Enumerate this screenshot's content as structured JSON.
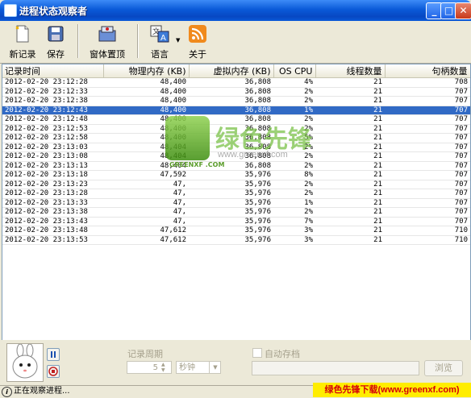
{
  "window": {
    "title": "进程状态观察者"
  },
  "toolbar": {
    "new_record": "新记录",
    "save": "保存",
    "window_top": "窗体置顶",
    "language": "语言",
    "about": "关于"
  },
  "table": {
    "columns": [
      "记录时间",
      "物理内存 (KB)",
      "虚拟内存 (KB)",
      "OS CPU",
      "线程数量",
      "句柄数量"
    ],
    "rows": [
      [
        "2012-02-20 23:12:28",
        "48,400",
        "36,808",
        "4%",
        "21",
        "708"
      ],
      [
        "2012-02-20 23:12:33",
        "48,400",
        "36,808",
        "2%",
        "21",
        "707"
      ],
      [
        "2012-02-20 23:12:38",
        "48,400",
        "36,808",
        "2%",
        "21",
        "707"
      ],
      [
        "2012-02-20 23:12:43",
        "48,400",
        "36,808",
        "1%",
        "21",
        "707"
      ],
      [
        "2012-02-20 23:12:48",
        "48,400",
        "36,808",
        "2%",
        "21",
        "707"
      ],
      [
        "2012-02-20 23:12:53",
        "48,400",
        "36,808",
        "2%",
        "21",
        "707"
      ],
      [
        "2012-02-20 23:12:58",
        "48,400",
        "36,808",
        "5%",
        "21",
        "707"
      ],
      [
        "2012-02-20 23:13:03",
        "48,404",
        "36,808",
        "2%",
        "21",
        "707"
      ],
      [
        "2012-02-20 23:13:08",
        "48,404",
        "36,808",
        "2%",
        "21",
        "707"
      ],
      [
        "2012-02-20 23:13:13",
        "48,404",
        "36,808",
        "2%",
        "21",
        "707"
      ],
      [
        "2012-02-20 23:13:18",
        "47,592",
        "35,976",
        "8%",
        "21",
        "707"
      ],
      [
        "2012-02-20 23:13:23",
        "47,",
        "35,976",
        "2%",
        "21",
        "707"
      ],
      [
        "2012-02-20 23:13:28",
        "47,",
        "35,976",
        "2%",
        "21",
        "707"
      ],
      [
        "2012-02-20 23:13:33",
        "47,",
        "35,976",
        "1%",
        "21",
        "707"
      ],
      [
        "2012-02-20 23:13:38",
        "47,",
        "35,976",
        "2%",
        "21",
        "707"
      ],
      [
        "2012-02-20 23:13:43",
        "47,",
        "35,976",
        "7%",
        "21",
        "707"
      ],
      [
        "2012-02-20 23:13:48",
        "47,612",
        "35,976",
        "3%",
        "21",
        "710"
      ],
      [
        "2012-02-20 23:13:53",
        "47,612",
        "35,976",
        "3%",
        "21",
        "710"
      ]
    ],
    "selected_row": 3
  },
  "settings": {
    "period_label": "记录周期",
    "period_value": "5",
    "period_unit": "秒钟",
    "auto_save_label": "自动存档",
    "browse_label": "浏览"
  },
  "status": {
    "text": "正在观察进程..."
  },
  "watermark": {
    "text": "绿色先锋",
    "url": "www.greenxf.com",
    "logo_text": "GREENXF .COM"
  },
  "banner": {
    "text": "绿色先锋下载(www.greenxf.com)"
  },
  "colors": {
    "selection": "#316ac5",
    "titlebar": "#0a5ad8",
    "banner_bg": "#ffed00",
    "banner_fg": "#d4000a"
  }
}
